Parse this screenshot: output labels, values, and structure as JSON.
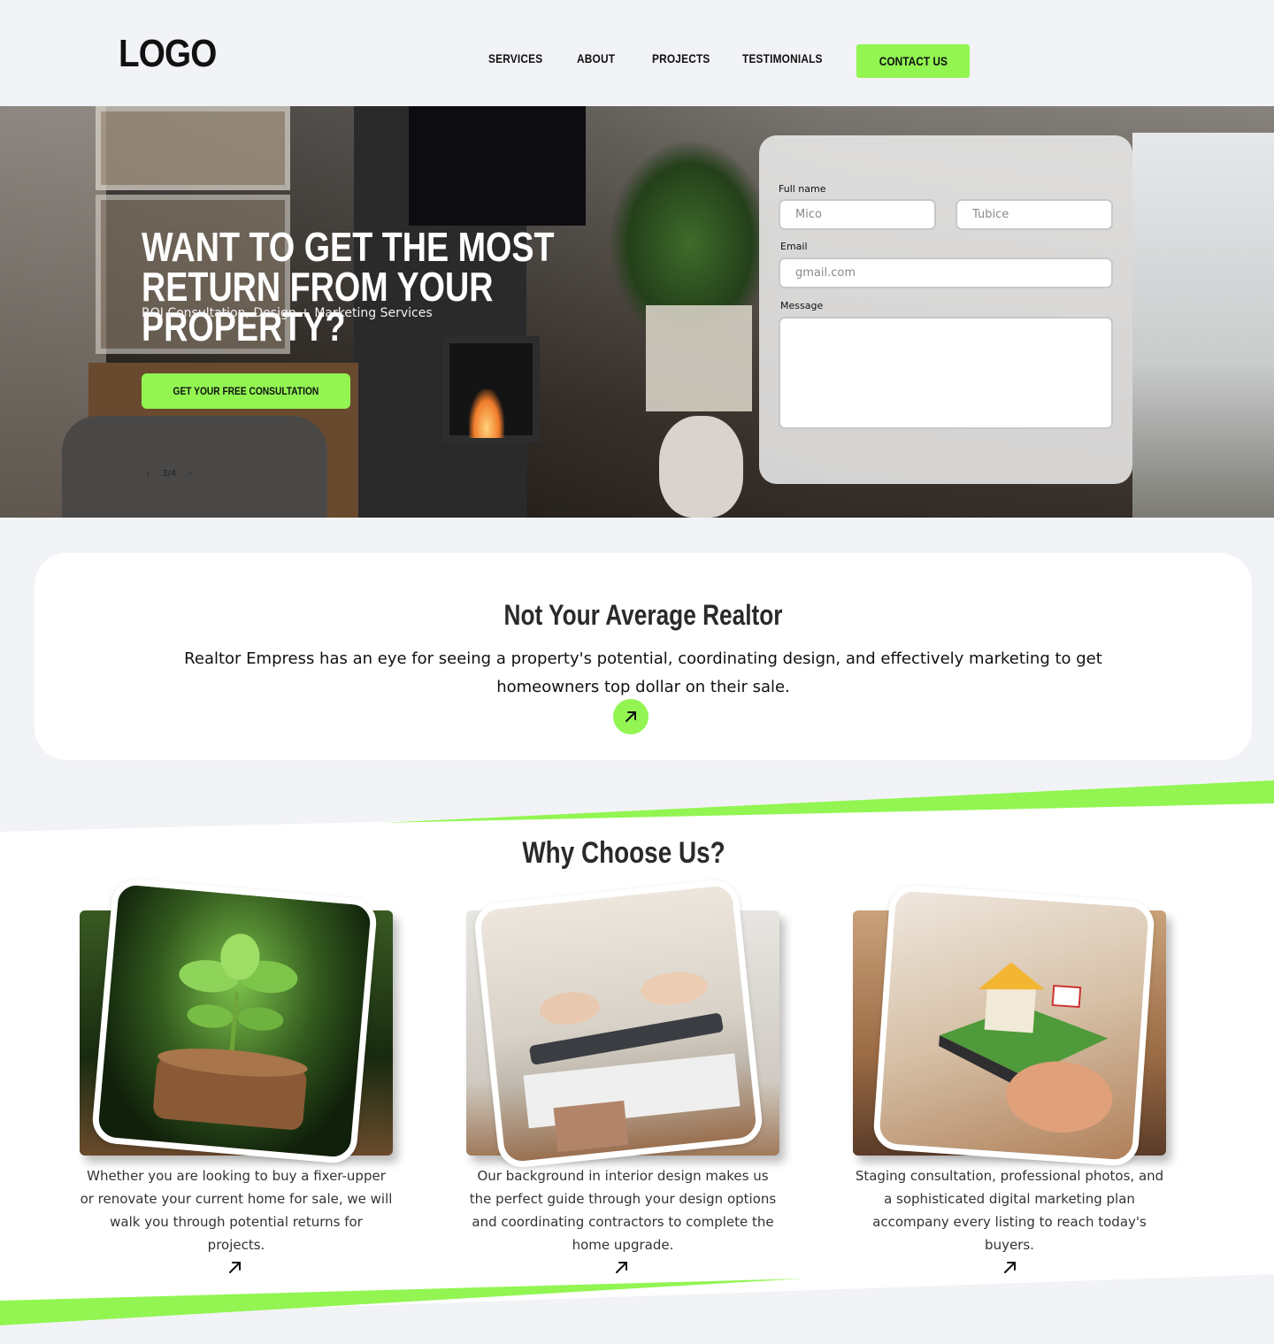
{
  "header": {
    "logo": "LOGO",
    "nav": [
      "SERVICES",
      "ABOUT",
      "PROJECTS",
      "TESTIMONIALS"
    ],
    "contact_label": "CONTACT US",
    "accent_color": "#92f552"
  },
  "hero": {
    "title": "WANT TO GET THE MOST RETURN FROM YOUR PROPERTY?",
    "subtitle": "ROI Consultation, Design + Marketing Services",
    "cta_label": "GET YOUR FREE CONSULTATION",
    "slide_indicator": "3/4",
    "prev_label": "‹",
    "next_label": "›"
  },
  "form": {
    "fullname_label": "Full name",
    "first_name_placeholder": "Mico",
    "last_name_placeholder": "Tubice",
    "email_label": "Email",
    "email_placeholder": "gmail.com",
    "message_label": "Message",
    "message_placeholder": ""
  },
  "about": {
    "title": "Not Your Average Realtor",
    "text": "Realtor Empress has an eye for seeing a property's potential, coordinating design, and effectively marketing to get homeowners top dollar on their sale."
  },
  "why": {
    "title": "Why Choose Us?",
    "cards": [
      {
        "image": "plant-growing-from-coins",
        "text": "Whether you are looking to buy a fixer-upper or renovate your current home for sale, we will walk you through potential returns for projects."
      },
      {
        "image": "design-consultation-hands",
        "text": "Our background in interior design makes us the perfect guide through your design options and coordinating contractors to complete the home upgrade."
      },
      {
        "image": "house-on-smartphone-for-sale",
        "text": "Staging consultation, professional photos, and a sophisticated digital marketing plan accompany every listing to reach today's buyers."
      }
    ]
  }
}
